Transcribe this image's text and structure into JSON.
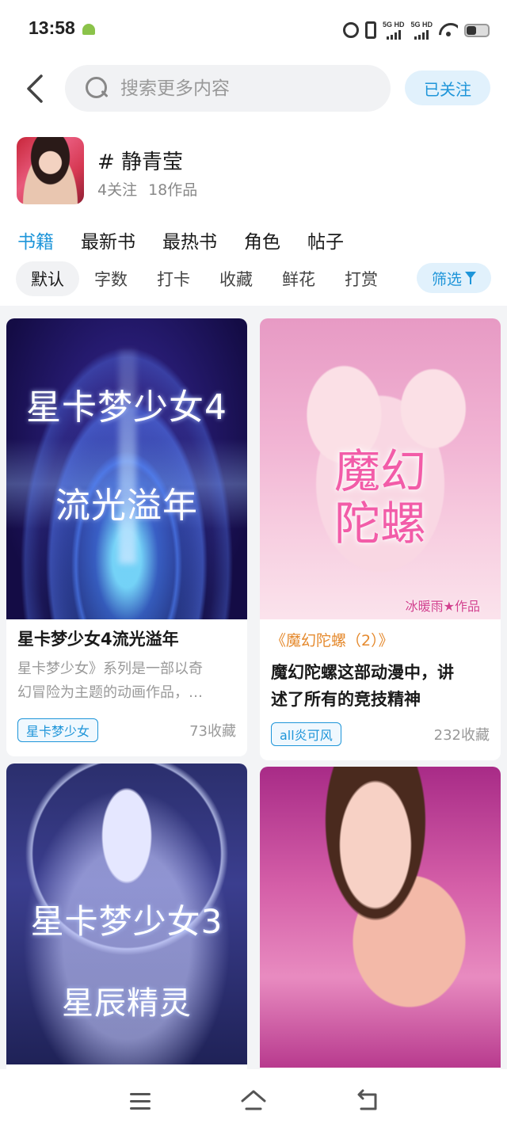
{
  "status_bar": {
    "time": "13:58",
    "network_1": "5G HD",
    "network_2": "5G HD"
  },
  "header": {
    "search_placeholder": "搜索更多内容",
    "follow_label": "已关注"
  },
  "topic": {
    "title": "# 静青莹",
    "followers": "4关注",
    "works": "18作品"
  },
  "tabs": [
    {
      "label": "书籍",
      "active": true
    },
    {
      "label": "最新书"
    },
    {
      "label": "最热书"
    },
    {
      "label": "角色"
    },
    {
      "label": "帖子"
    }
  ],
  "sort": {
    "items": [
      "默认",
      "字数",
      "打卡",
      "收藏",
      "鲜花",
      "打赏"
    ],
    "active": "默认",
    "filter_label": "筛选"
  },
  "cards": [
    {
      "cover_line_1": "星卡梦少女4",
      "cover_line_2": "流光溢年",
      "title": "星卡梦少女4流光溢年",
      "desc_line_1": "星卡梦少女》系列是一部以奇",
      "desc_line_2": "幻冒险为主题的动画作品，…",
      "tag": "星卡梦少女",
      "count": "73收藏"
    },
    {
      "cover_title_line_1": "魔幻",
      "cover_title_line_2": "陀螺",
      "cover_author": "冰暖雨★作品",
      "subtitle": "《魔幻陀螺（2）》",
      "title_line_1": "魔幻陀螺这部动漫中，讲",
      "title_line_2": "述了所有的竞技精神",
      "tag": "all炎可风",
      "count": "232收藏"
    },
    {
      "cover_line_1": "星卡梦少女3",
      "cover_line_2": "星辰精灵"
    },
    {}
  ],
  "colors": {
    "accent": "#1e95d9",
    "accent_bg": "#e1f1fc",
    "subtitle_orange": "#e58a2e"
  }
}
